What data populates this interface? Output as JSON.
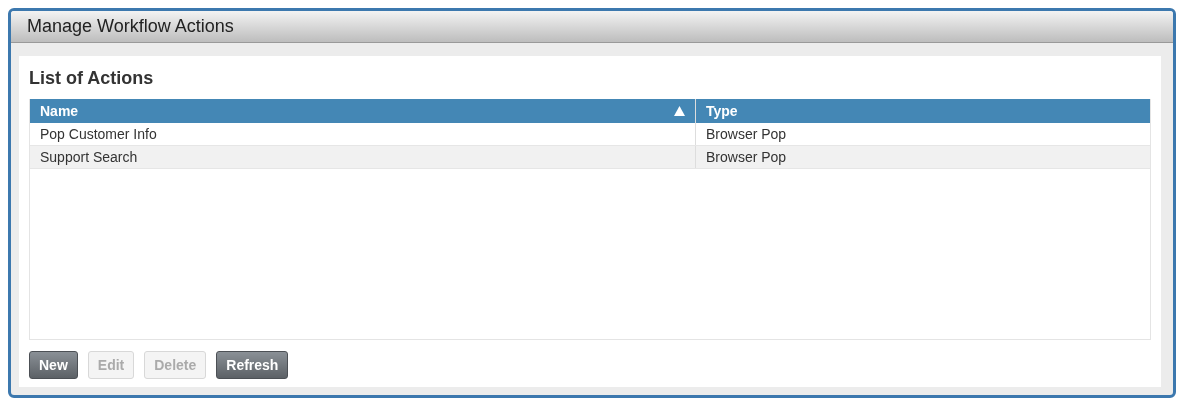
{
  "window": {
    "title": "Manage Workflow Actions"
  },
  "panel": {
    "heading": "List of Actions"
  },
  "table": {
    "columns": [
      {
        "label": "Name",
        "sorted": true
      },
      {
        "label": "Type",
        "sorted": false
      }
    ],
    "rows": [
      {
        "cells": [
          "Pop Customer Info",
          "Browser Pop"
        ],
        "selected": false
      },
      {
        "cells": [
          "Support Search",
          "Browser Pop"
        ],
        "selected": false
      }
    ]
  },
  "buttons": [
    {
      "label": "New",
      "disabled": false
    },
    {
      "label": "Edit",
      "disabled": true
    },
    {
      "label": "Delete",
      "disabled": true
    },
    {
      "label": "Refresh",
      "disabled": false
    }
  ]
}
